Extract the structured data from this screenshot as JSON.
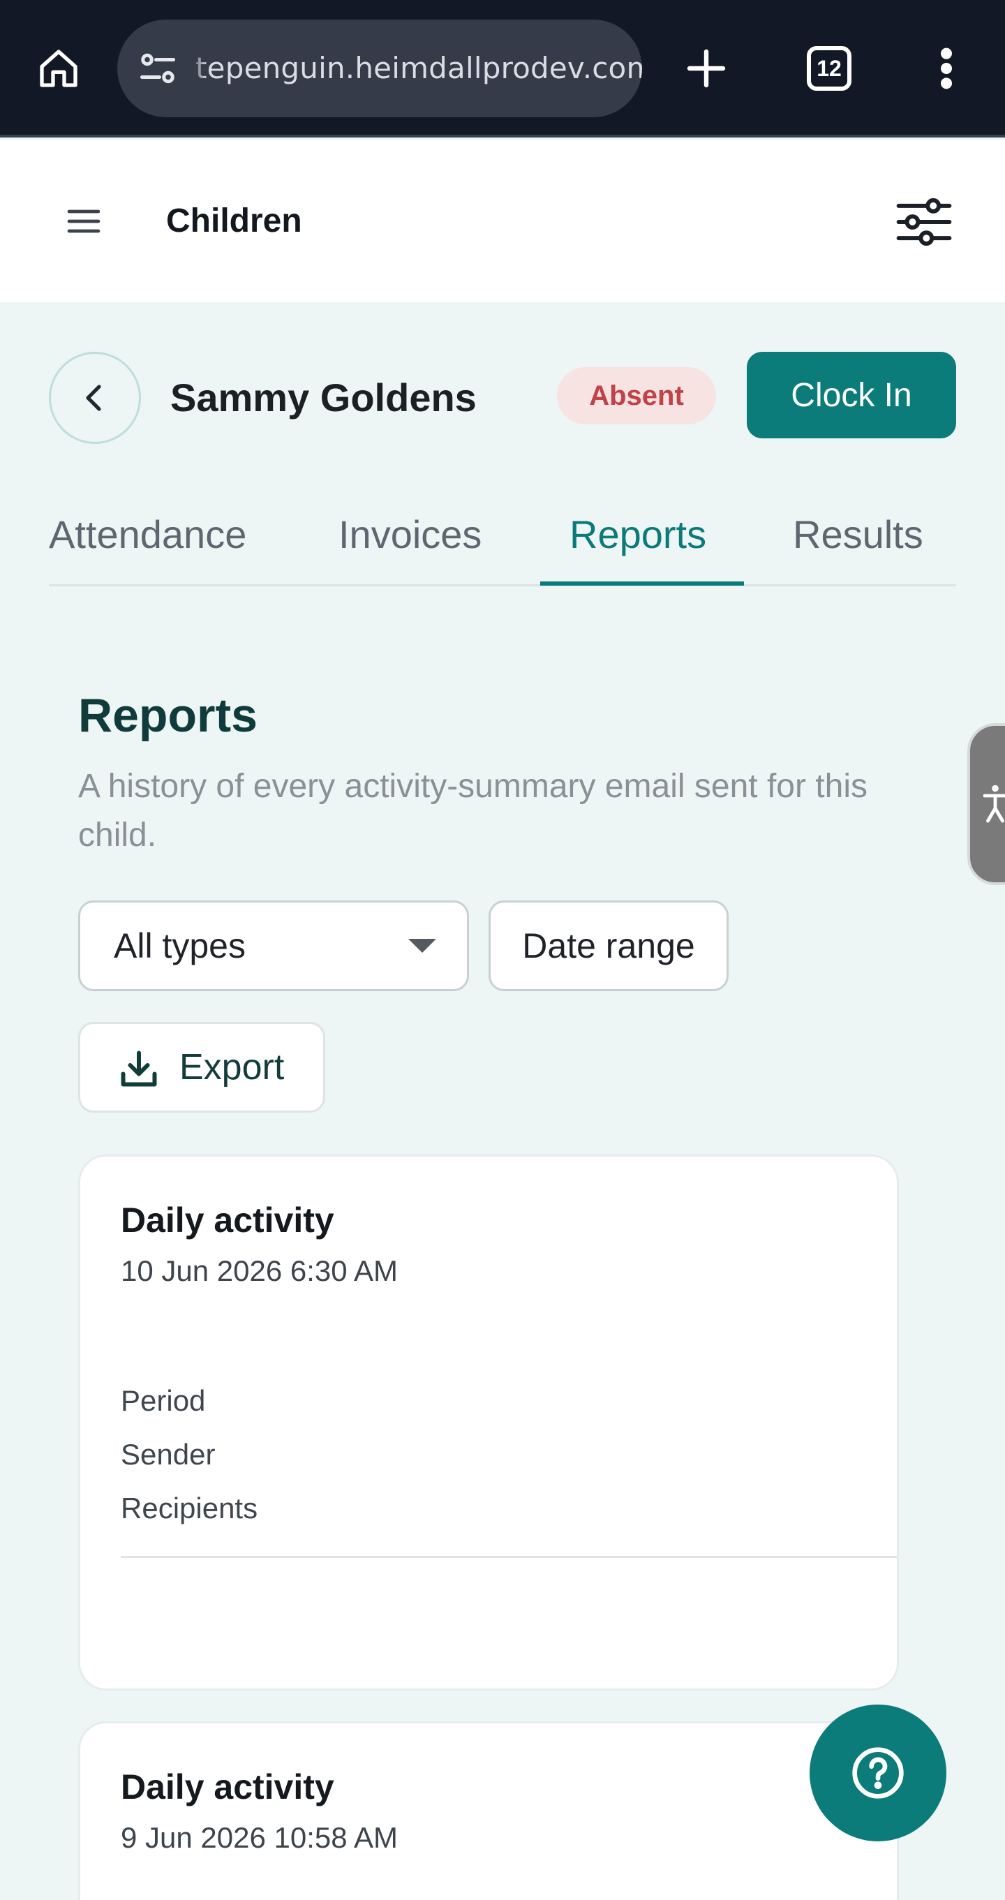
{
  "browser": {
    "url": "tepenguin.heimdallprodev.com",
    "tab_count": "12",
    "icons": {
      "home": "home-icon",
      "site": "site-settings-icon",
      "new_tab": "plus-icon",
      "tabs": "tab-switcher-icon",
      "menu": "more-vert-icon"
    }
  },
  "header": {
    "title": "Children",
    "menu_icon": "hamburger-icon",
    "filter_icon": "sliders-icon"
  },
  "child": {
    "name": "Sammy Goldens",
    "status": "Absent",
    "clock_in_label": "Clock In",
    "back_icon": "chevron-left-icon"
  },
  "tabs": [
    {
      "label": "Attendance",
      "active": false
    },
    {
      "label": "Invoices",
      "active": false
    },
    {
      "label": "Reports",
      "active": true
    },
    {
      "label": "Results",
      "active": false
    }
  ],
  "reports": {
    "title": "Reports",
    "description": "A history of every activity-summary email sent for this child.",
    "type_filter": "All types",
    "date_range_label": "Date range",
    "export_label": "Export",
    "items": [
      {
        "type": "Daily activity",
        "date": "10 Jun 2026 6:30 AM",
        "fields": [
          "Period",
          "Sender",
          "Recipients"
        ]
      },
      {
        "type": "Daily activity",
        "date": "9 Jun 2026 10:58 AM"
      }
    ]
  },
  "colors": {
    "accent": "#0b7c7a",
    "page_bg": "#edf5f5",
    "absent_bg": "#f8e3e3",
    "absent_text": "#c0434a",
    "browser_bar": "#121826"
  },
  "help_icon": "help-circle-icon",
  "accessibility_icon": "accessibility-icon"
}
